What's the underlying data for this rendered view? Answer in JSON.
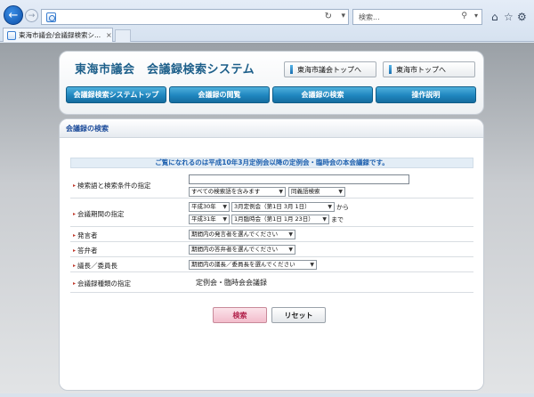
{
  "browser": {
    "address_value": "",
    "search_placeholder": "検索...",
    "tab_label": "東海市議会/会議録検索シ...",
    "tab_close": "×"
  },
  "header": {
    "site_title": "東海市議会　会議録検索システム",
    "top_links": [
      "東海市議会トップへ",
      "東海市トップへ"
    ],
    "menu": [
      "会議録検索システムトップ",
      "会議録の閲覧",
      "会議録の検索",
      "操作説明"
    ]
  },
  "search_form": {
    "section_title": "会議録の検索",
    "notice": "ご覧になれるのは平成10年3月定例会以降の定例会・臨時会の本会議録です。",
    "rows": {
      "keyword": {
        "label": "検索語と検索条件の指定",
        "input_value": "",
        "condition": "すべての検索語を含みます",
        "synonym": "同義語検索"
      },
      "period": {
        "label": "会議期間の指定",
        "from_year": "平成30年",
        "from_session": "3月定例会（第1日 3月 1日）",
        "from_suffix": "から",
        "to_year": "平成31年",
        "to_session": "1月臨時会（第1日 1月 23日）",
        "to_suffix": "まで"
      },
      "speaker": {
        "label": "発言者",
        "select": "期間内の発言者を選んでください"
      },
      "respondent": {
        "label": "答弁者",
        "select": "期間内の答弁者を選んでください"
      },
      "chair": {
        "label": "議長／委員長",
        "select": "期間内の議長／委員長を選んでください"
      },
      "record_type": {
        "label": "会議録種類の指定",
        "value": "定例会・臨時会会議録"
      }
    },
    "buttons": {
      "search": "検索",
      "reset": "リセット"
    }
  },
  "colors": {
    "title": "#1d5f8a",
    "menu_button": "#1f86bf",
    "notice_text": "#1c5fae",
    "search_button_text": "#b3234d"
  }
}
